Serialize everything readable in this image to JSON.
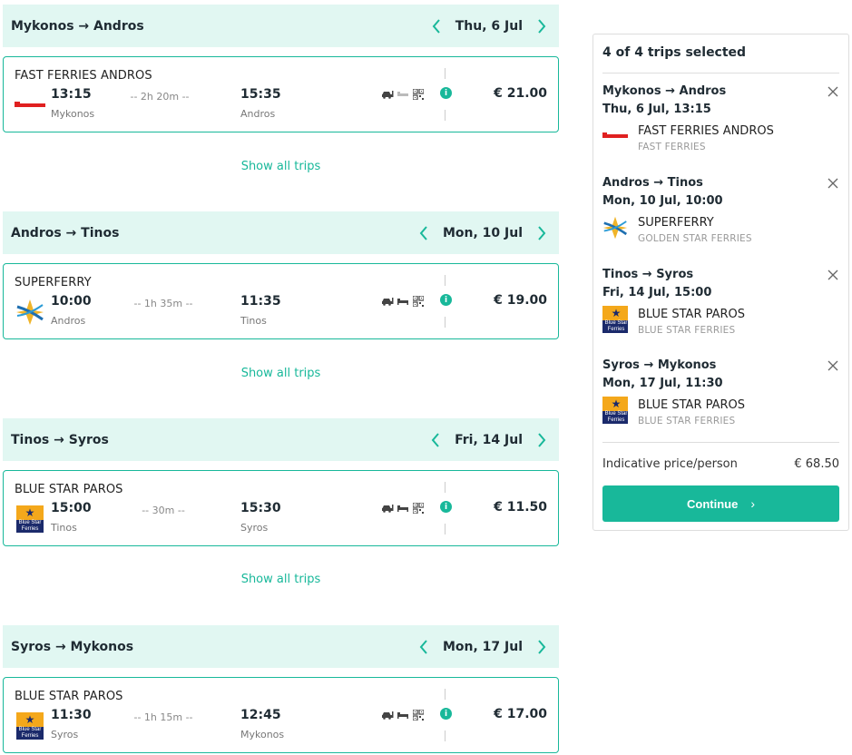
{
  "legs": [
    {
      "title": "Mykonos → Andros",
      "date": "Thu, 6 Jul",
      "operator": "FAST FERRIES ANDROS",
      "logo": "fast-ferries-logo",
      "dep_time": "13:15",
      "dep_port": "Mykonos",
      "duration": "-- 2h 20m --",
      "arr_time": "15:35",
      "arr_port": "Andros",
      "price": "€ 21.00",
      "show_all": "Show all trips"
    },
    {
      "title": "Andros → Tinos",
      "date": "Mon, 10 Jul",
      "operator": "SUPERFERRY",
      "logo": "golden-star-logo",
      "dep_time": "10:00",
      "dep_port": "Andros",
      "duration": "-- 1h 35m --",
      "arr_time": "11:35",
      "arr_port": "Tinos",
      "price": "€ 19.00",
      "show_all": "Show all trips"
    },
    {
      "title": "Tinos → Syros",
      "date": "Fri, 14 Jul",
      "operator": "BLUE STAR PAROS",
      "logo": "blue-star-logo",
      "dep_time": "15:00",
      "dep_port": "Tinos",
      "duration": "-- 30m --",
      "arr_time": "15:30",
      "arr_port": "Syros",
      "price": "€ 11.50",
      "show_all": "Show all trips"
    },
    {
      "title": "Syros → Mykonos",
      "date": "Mon, 17 Jul",
      "operator": "BLUE STAR PAROS",
      "logo": "blue-star-logo",
      "dep_time": "11:30",
      "dep_port": "Syros",
      "duration": "-- 1h 15m --",
      "arr_time": "12:45",
      "arr_port": "Mykonos",
      "price": "€ 17.00"
    }
  ],
  "summary": {
    "title": "4 of 4 trips selected",
    "items": [
      {
        "route": "Mykonos → Andros",
        "datetime": "Thu, 6 Jul, 13:15",
        "operator": "FAST FERRIES ANDROS",
        "company": "FAST FERRIES"
      },
      {
        "route": "Andros → Tinos",
        "datetime": "Mon, 10 Jul, 10:00",
        "operator": "SUPERFERRY",
        "company": "GOLDEN STAR FERRIES"
      },
      {
        "route": "Tinos → Syros",
        "datetime": "Fri, 14 Jul, 15:00",
        "operator": "BLUE STAR PAROS",
        "company": "BLUE STAR FERRIES"
      },
      {
        "route": "Syros → Mykonos",
        "datetime": "Mon, 17 Jul, 11:30",
        "operator": "BLUE STAR PAROS",
        "company": "BLUE STAR FERRIES"
      }
    ],
    "price_label": "Indicative price/person",
    "price_value": "€ 68.50",
    "continue_label": "Continue"
  },
  "logos": {
    "fast_ferries_text": "FAST FERRIES",
    "blue_star_text": "Blue Star Ferries"
  },
  "colors": {
    "accent": "#18b89a",
    "header_bg": "#e1f7f2",
    "blue_star_navy": "#1b2a6b",
    "blue_star_orange": "#f4a81b",
    "fast_ferries_red": "#e02020"
  }
}
